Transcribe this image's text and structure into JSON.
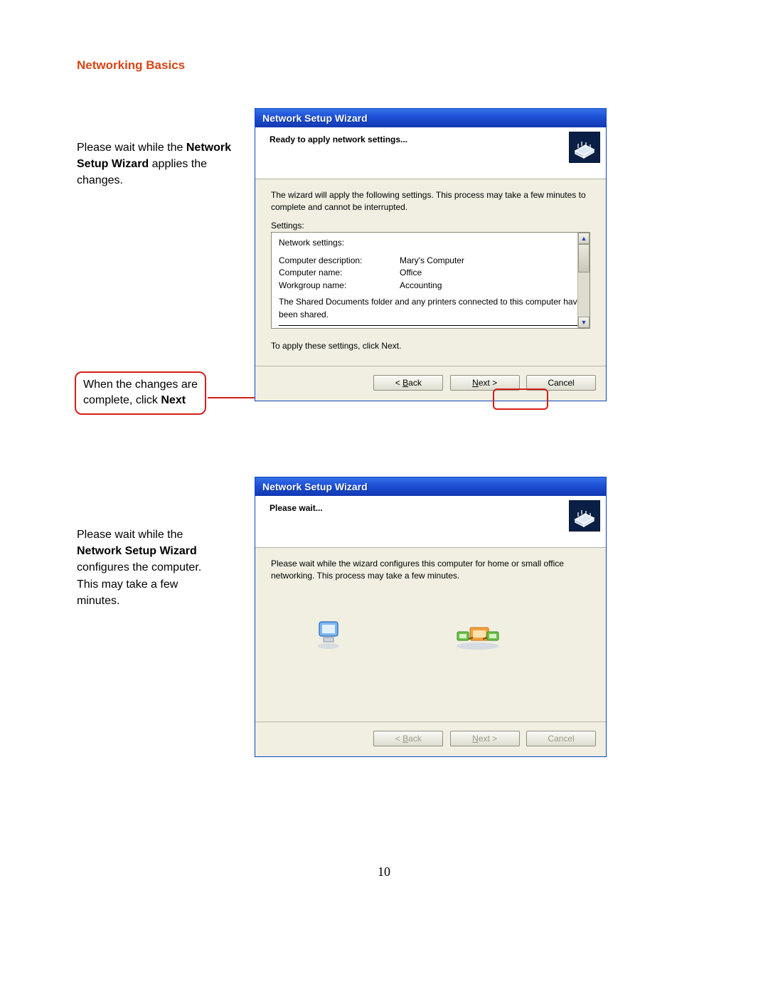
{
  "section_title": "Networking Basics",
  "page_number": "10",
  "side_note_1": {
    "prefix": "Please wait while the ",
    "bold": "Network Setup Wizard",
    "suffix": " applies the changes."
  },
  "callout": {
    "line1": "When the changes are",
    "line2_prefix": "complete, click ",
    "line2_bold": "Next"
  },
  "side_note_2": {
    "line1": "Please wait while the",
    "bold": "Network Setup Wizard",
    "line3": "configures the computer.",
    "line4": "This may take a few",
    "line5": "minutes."
  },
  "wizard1": {
    "title": "Network Setup Wizard",
    "header": "Ready to apply network settings...",
    "body_para": "The wizard will apply the following settings. This process may take a few minutes to complete and cannot be interrupted.",
    "settings_label": "Settings:",
    "settings_heading": "Network settings:",
    "rows": [
      {
        "key": "Computer description:",
        "val": "Mary's Computer"
      },
      {
        "key": "Computer name:",
        "val": "Office"
      },
      {
        "key": "Workgroup name:",
        "val": "Accounting"
      }
    ],
    "shared_line": "The Shared Documents folder and any printers connected to this computer have been shared.",
    "apply_hint": "To apply these settings, click Next.",
    "buttons": {
      "back": "< Back",
      "next": "Next >",
      "cancel": "Cancel"
    }
  },
  "wizard2": {
    "title": "Network Setup Wizard",
    "header": "Please wait...",
    "body_para": "Please wait while the wizard configures this computer for home or small office networking. This process may take a few minutes.",
    "buttons": {
      "back": "< Back",
      "next": "Next >",
      "cancel": "Cancel"
    }
  }
}
